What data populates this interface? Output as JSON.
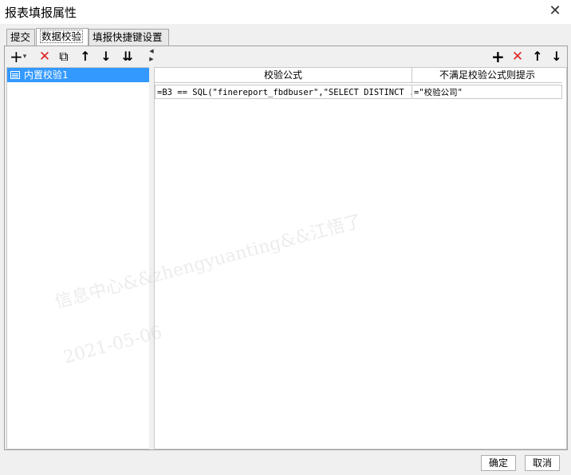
{
  "window": {
    "title": "报表填报属性",
    "close_glyph": "✕"
  },
  "tabs": [
    {
      "label": "提交",
      "active": false
    },
    {
      "label": "数据校验",
      "active": true
    },
    {
      "label": "填报快捷键设置",
      "active": false
    }
  ],
  "left_toolbar": {
    "add": "+",
    "add_dropdown": "▾",
    "delete": "✕",
    "copy": "⧉",
    "up": "↑",
    "down": "↓",
    "sort": "⇊"
  },
  "tree": {
    "items": [
      {
        "label": "内置校验1",
        "selected": true
      }
    ]
  },
  "splitter": {
    "left_arrow": "◀",
    "right_arrow": "▶"
  },
  "right_toolbar": {
    "add": "+",
    "delete": "✕",
    "up": "↑",
    "down": "↓"
  },
  "table": {
    "columns": [
      "校验公式",
      "不满足校验公式则提示"
    ],
    "rows": [
      [
        "=B3 == SQL(\"finereport_fbdbuser\",\"SELECT DISTINCT ...",
        "=\"校验公司\""
      ]
    ]
  },
  "footer": {
    "ok": "确定",
    "cancel": "取消"
  },
  "watermark": {
    "line1": "信息中心&&zhengyuanting&&江悟了",
    "line2": "2021-05-06"
  },
  "colors": {
    "selection": "#3399ff",
    "delete_red": "#e02020"
  }
}
